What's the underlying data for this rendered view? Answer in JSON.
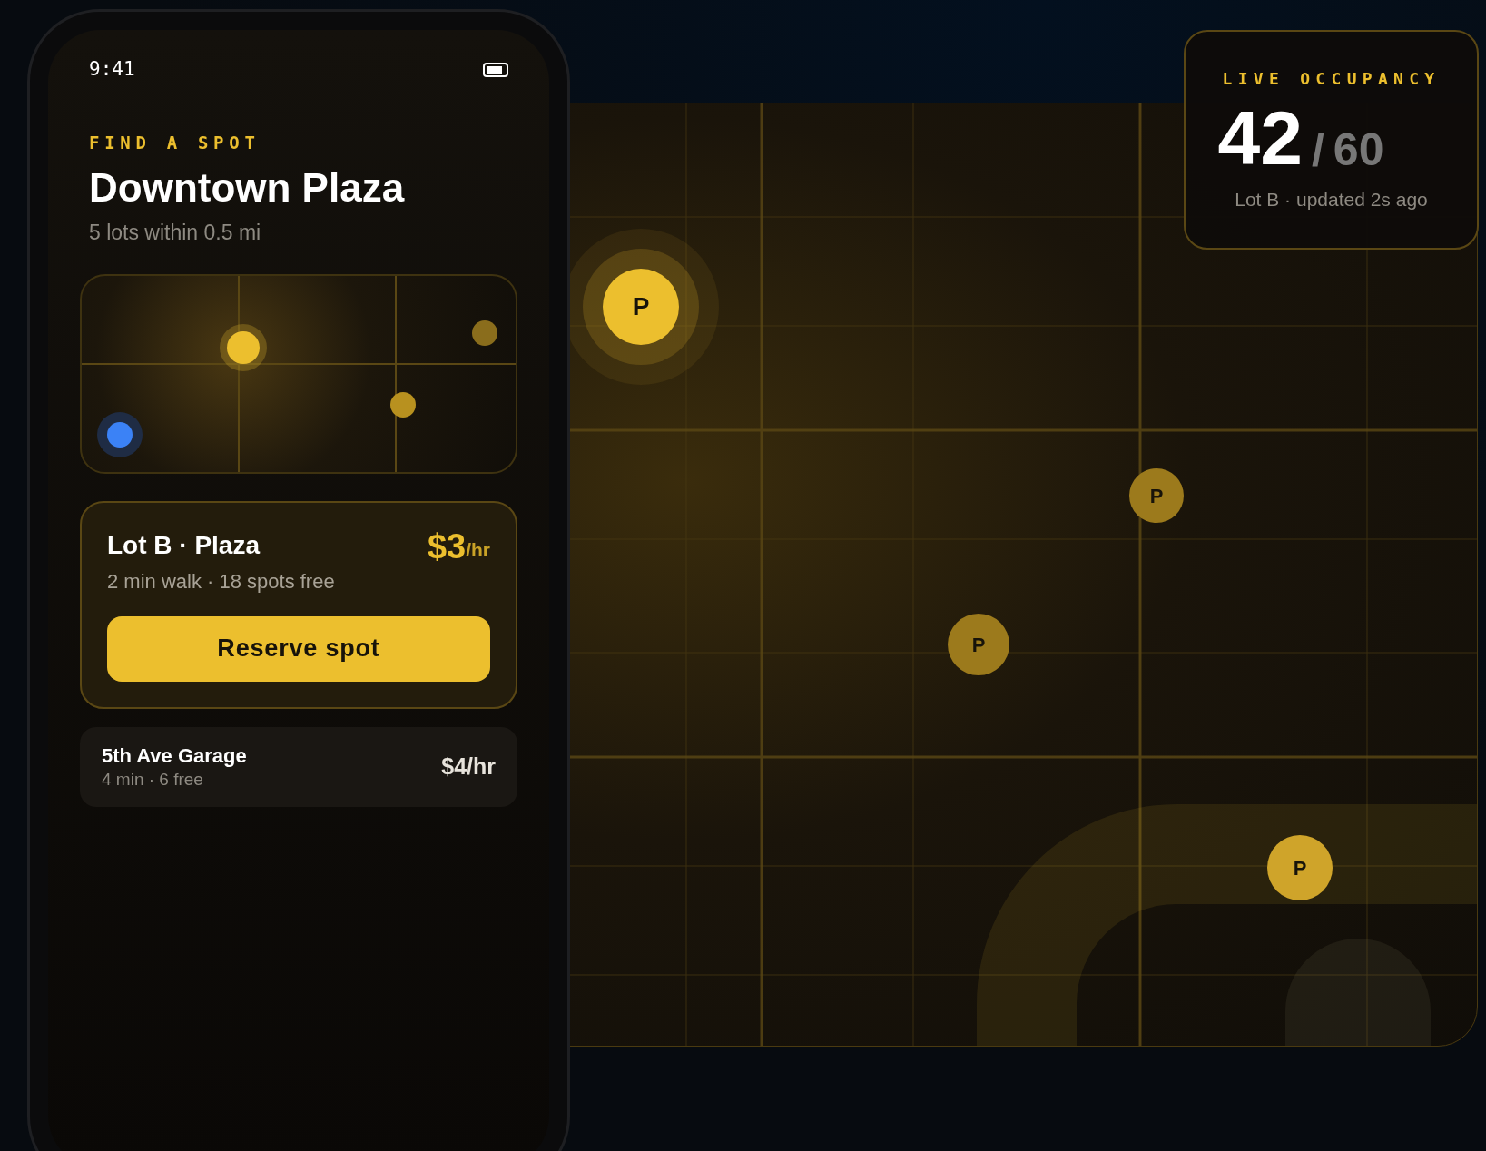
{
  "phone": {
    "time": "9:41",
    "eyebrow": "FIND A SPOT",
    "title": "Downtown Plaza",
    "subtitle": "5 lots within 0.5 mi",
    "featured_lot": {
      "name": "Lot B · Plaza",
      "detail": "2 min walk · 18 spots free",
      "price": "$3",
      "unit": "/hr",
      "button": "Reserve spot"
    },
    "lots": [
      {
        "name": "5th Ave Garage",
        "detail": "4 min · 6 free",
        "price": "$4/hr"
      }
    ]
  },
  "map": {
    "pins": [
      {
        "label": "P",
        "kind": "highlight"
      },
      {
        "label": "P",
        "kind": "dim"
      },
      {
        "label": "P",
        "kind": "dim"
      },
      {
        "label": "P",
        "kind": "bright"
      }
    ]
  },
  "occupancy": {
    "eyebrow": "LIVE OCCUPANCY",
    "count": "42",
    "separator": "/",
    "total": "60",
    "caption": "Lot B · updated 2s ago"
  }
}
